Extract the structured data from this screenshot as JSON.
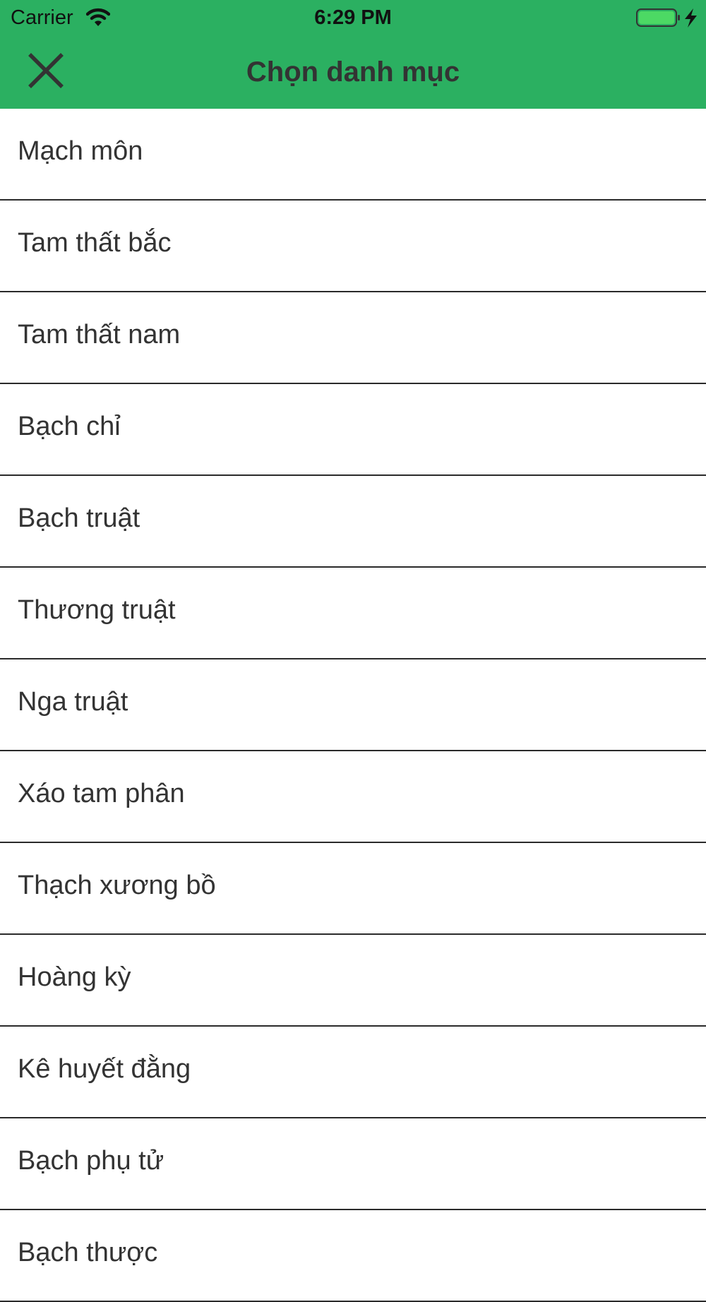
{
  "status_bar": {
    "carrier": "Carrier",
    "time": "6:29 PM",
    "battery_color": "#4cd964",
    "icons": [
      "wifi-icon",
      "battery-icon",
      "charging-bolt-icon"
    ]
  },
  "header": {
    "title": "Chọn danh mục",
    "background_color": "#2bb061",
    "close_icon": "close-icon"
  },
  "categories": [
    {
      "label": "Mạch môn"
    },
    {
      "label": "Tam thất bắc"
    },
    {
      "label": "Tam thất nam"
    },
    {
      "label": "Bạch chỉ"
    },
    {
      "label": "Bạch truật"
    },
    {
      "label": "Thương truật"
    },
    {
      "label": "Nga truật"
    },
    {
      "label": "Xáo tam phân"
    },
    {
      "label": "Thạch xương bồ"
    },
    {
      "label": "Hoàng kỳ"
    },
    {
      "label": "Kê huyết đằng"
    },
    {
      "label": "Bạch phụ tử"
    },
    {
      "label": "Bạch thược"
    }
  ]
}
